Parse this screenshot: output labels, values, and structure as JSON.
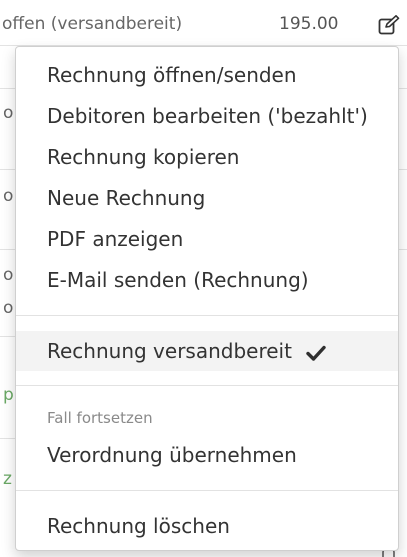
{
  "table": {
    "top_row": {
      "status": "offen (versandbereit)",
      "amount": "195.00",
      "edit_icon": "edit-icon"
    },
    "left_fragments": [
      "o",
      "o",
      "o",
      "o",
      "p",
      "z"
    ]
  },
  "menu": {
    "items": [
      {
        "label": "Rechnung öffnen/senden"
      },
      {
        "label": "Debitoren bearbeiten ('bezahlt')"
      },
      {
        "label": "Rechnung kopieren"
      },
      {
        "label": "Neue Rechnung"
      },
      {
        "label": "PDF anzeigen"
      },
      {
        "label": "E-Mail senden (Rechnung)"
      }
    ],
    "versandbereit": {
      "label": "Rechnung versandbereit",
      "checked": true,
      "icon": "checkmark-icon"
    },
    "section_header": "Fall fortsetzen",
    "verordnung": {
      "label": "Verordnung übernehmen"
    },
    "delete": {
      "label": "Rechnung löschen"
    }
  },
  "colors": {
    "accent_green": "#6aa865",
    "text": "#333333",
    "muted": "#8a8a8a"
  }
}
